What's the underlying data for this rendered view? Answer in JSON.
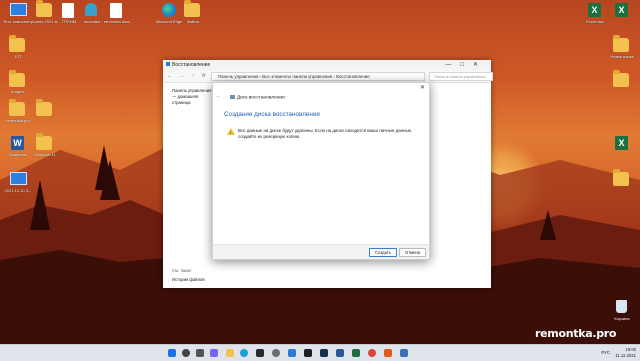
{
  "desktop": {
    "icons": [
      {
        "label": "Этот компьютер",
        "icon": "monitor-icon"
      },
      {
        "label": "Lumia 2021 м",
        "icon": "folder-icon"
      },
      {
        "label": "ПТКНМ",
        "icon": "document-icon"
      },
      {
        "label": "remontka",
        "icon": "user-icon"
      },
      {
        "label": "remontka.docx",
        "icon": "document-icon"
      },
      {
        "label": "Microsoft Edge",
        "icon": "edge-icon"
      },
      {
        "label": "Файлы",
        "icon": "folder-icon"
      },
      {
        "label": "1ПТ",
        "icon": "folder-icon"
      },
      {
        "label": "images",
        "icon": "folder-icon"
      },
      {
        "label": "remontka.pro",
        "icon": "folder-icon"
      },
      {
        "label": "Workbook",
        "icon": "word-icon"
      },
      {
        "label": "Windows 11",
        "icon": "folder-icon"
      },
      {
        "label": "2021.12.10 3...",
        "icon": "monitor-icon"
      },
      {
        "label": "Excel.xlsx",
        "icon": "excel-icon"
      },
      {
        "label": "",
        "icon": "excel-icon"
      },
      {
        "label": "Новая папка",
        "icon": "folder-icon"
      },
      {
        "label": "Корзина",
        "icon": "recycle-bin-icon"
      }
    ],
    "watermark": "remontka.pro"
  },
  "window": {
    "title": "Восстановление",
    "controls": [
      "—",
      "□",
      "✕"
    ],
    "nav_arrows": "← → ↑ ⟳",
    "breadcrumb": "Панель управления  ›  Все элементы панели управления  ›  Восстановление",
    "search_placeholder": "Поиск в панели управления",
    "side_link_home": "Панель управления — домашняя страница",
    "side_see_also": "См. также",
    "side_file_history": "История файлов"
  },
  "dialog": {
    "header": "Диск восстановления",
    "close": "✕",
    "back": "←",
    "title": "Создание диска восстановления",
    "warning_text": "Все данные на диске будут удалены. Если на диске находятся ваши личные данные, создайте их резервную копию.",
    "buttons": {
      "create": "Создать",
      "cancel": "Отмена"
    }
  },
  "taskbar": {
    "items": [
      "windows-start-icon",
      "search-icon",
      "task-view-icon",
      "chat-icon",
      "file-explorer-icon",
      "edge-icon",
      "store-icon",
      "settings-icon",
      "vscode-icon",
      "terminal-icon",
      "photoshop-icon",
      "word-icon",
      "excel-icon",
      "chrome-icon",
      "app-icon",
      "app-icon"
    ],
    "lang": "РУС",
    "time": "19:00",
    "date": "11.12.2021"
  },
  "colors": {
    "accent": "#1e5fb5",
    "warning": "#f2c22e",
    "taskbar": "#dfe3ea"
  }
}
